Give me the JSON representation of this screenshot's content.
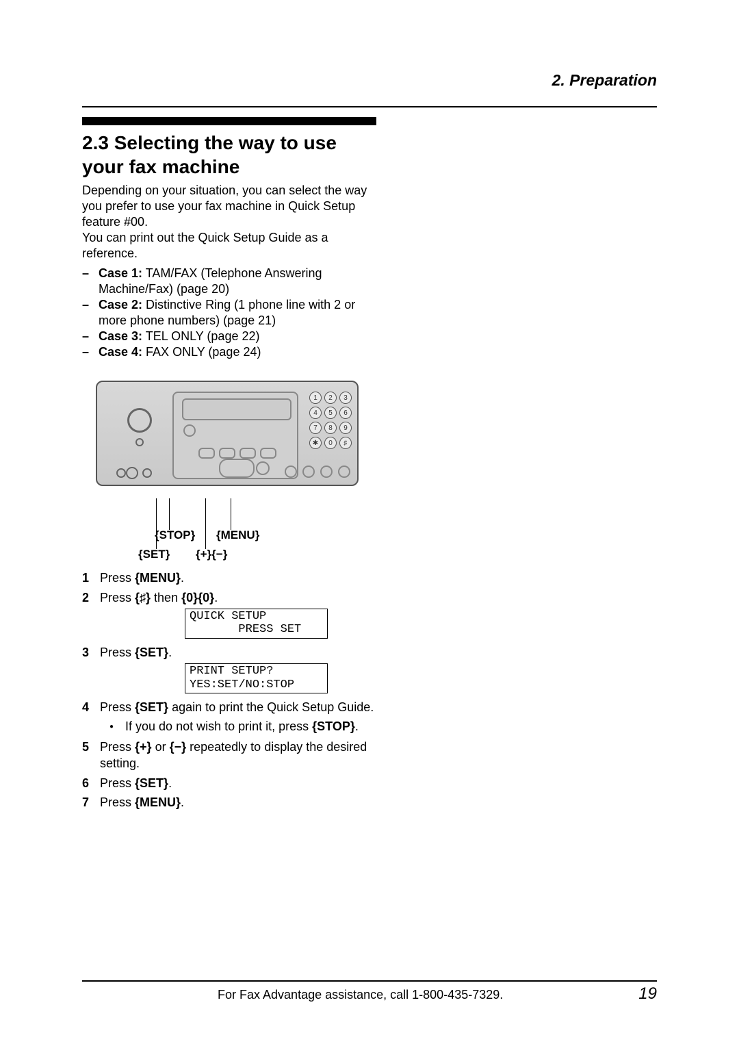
{
  "header": {
    "chapter": "2. Preparation"
  },
  "section": {
    "number": "2.3",
    "title": "Selecting the way to use your fax machine",
    "intro1": "Depending on your situation, you can select the way you prefer to use your fax machine in Quick Setup feature #00.",
    "intro2": "You can print out the Quick Setup Guide as a reference."
  },
  "cases": [
    {
      "label": "Case 1:",
      "text": " TAM/FAX (Telephone Answering Machine/Fax) (page 20)"
    },
    {
      "label": "Case 2:",
      "text": " Distinctive Ring (1 phone line with 2 or more phone numbers) (page 21)"
    },
    {
      "label": "Case 3:",
      "text": " TEL ONLY (page 22)"
    },
    {
      "label": "Case 4:",
      "text": " FAX ONLY (page 24)"
    }
  ],
  "callouts": {
    "stop": "STOP",
    "menu": "MENU",
    "set": "SET",
    "plusminus": "+  −"
  },
  "keypad": [
    "1",
    "2",
    "3",
    "4",
    "5",
    "6",
    "7",
    "8",
    "9",
    "✱",
    "0",
    "♯"
  ],
  "steps": {
    "s1_press": "Press ",
    "s1_key": "MENU",
    "s1_end": ".",
    "s2_press": "Press ",
    "s2_key1": "♯",
    "s2_then": " then ",
    "s2_key2": "0",
    "s2_key3": "0",
    "s2_end": ".",
    "lcd1_line1": "QUICK SETUP",
    "lcd1_line2": "       PRESS SET",
    "s3_press": "Press ",
    "s3_key": "SET",
    "s3_end": ".",
    "lcd2_line1": "PRINT SETUP?",
    "lcd2_line2": "YES:SET/NO:STOP",
    "s4_a": "Press ",
    "s4_key": "SET",
    "s4_b": " again to print the Quick Setup Guide.",
    "s4_bullet_a": "If you do not wish to print it, press ",
    "s4_bullet_key": "STOP",
    "s4_bullet_b": ".",
    "s5_a": "Press ",
    "s5_key1": "+",
    "s5_or": " or ",
    "s5_key2": "−",
    "s5_b": " repeatedly to display the desired setting.",
    "s6_press": "Press ",
    "s6_key": "SET",
    "s6_end": ".",
    "s7_press": "Press ",
    "s7_key": "MENU",
    "s7_end": "."
  },
  "footer": {
    "assist": "For Fax Advantage assistance, call 1-800-435-7329.",
    "page": "19"
  }
}
